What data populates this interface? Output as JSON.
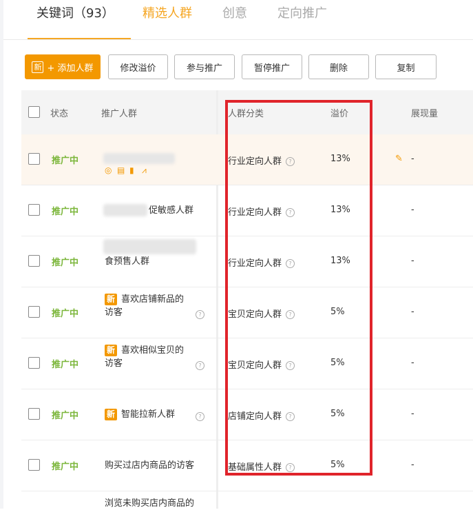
{
  "tabs": {
    "keywords": "关键词（93）",
    "selected": "精选人群",
    "creative": "创意",
    "targeting": "定向推广"
  },
  "toolbar": {
    "new_badge": "新",
    "add": "+ 添加人群",
    "edit_premium": "修改溢价",
    "join": "参与推广",
    "pause": "暂停推广",
    "delete": "删除",
    "copy": "复制"
  },
  "table": {
    "headers": {
      "status": "状态",
      "crowd": "推广人群",
      "category": "人群分类",
      "premium": "溢价",
      "impressions": "展现量"
    },
    "rows": [
      {
        "status": "推广中",
        "name": "",
        "category": "行业定向人群",
        "premium": "13%",
        "impressions": "-"
      },
      {
        "status": "推广中",
        "name": "促敏感人群",
        "category": "行业定向人群",
        "premium": "13%",
        "impressions": "-"
      },
      {
        "status": "推广中",
        "name": "食预售人群",
        "category": "行业定向人群",
        "premium": "13%",
        "impressions": "-"
      },
      {
        "status": "推广中",
        "new": "新",
        "name_line1": "喜欢店铺新品的",
        "name_line2": "访客",
        "category": "宝贝定向人群",
        "premium": "5%",
        "impressions": "-"
      },
      {
        "status": "推广中",
        "new": "新",
        "name_line1": "喜欢相似宝贝的",
        "name_line2": "访客",
        "category": "宝贝定向人群",
        "premium": "5%",
        "impressions": "-"
      },
      {
        "status": "推广中",
        "new": "新",
        "name": "智能拉新人群",
        "category": "店铺定向人群",
        "premium": "5%",
        "impressions": "-"
      },
      {
        "status": "推广中",
        "name": "购买过店内商品的访客",
        "category": "基础属性人群",
        "premium": "5%",
        "impressions": "-"
      },
      {
        "name": "浏览未购买店内商品的"
      }
    ]
  },
  "icons": {
    "help": "?",
    "edit": "✎"
  },
  "colors": {
    "accent": "#f39800",
    "status_green": "#7bb63a",
    "highlight_box": "#e0242b"
  }
}
